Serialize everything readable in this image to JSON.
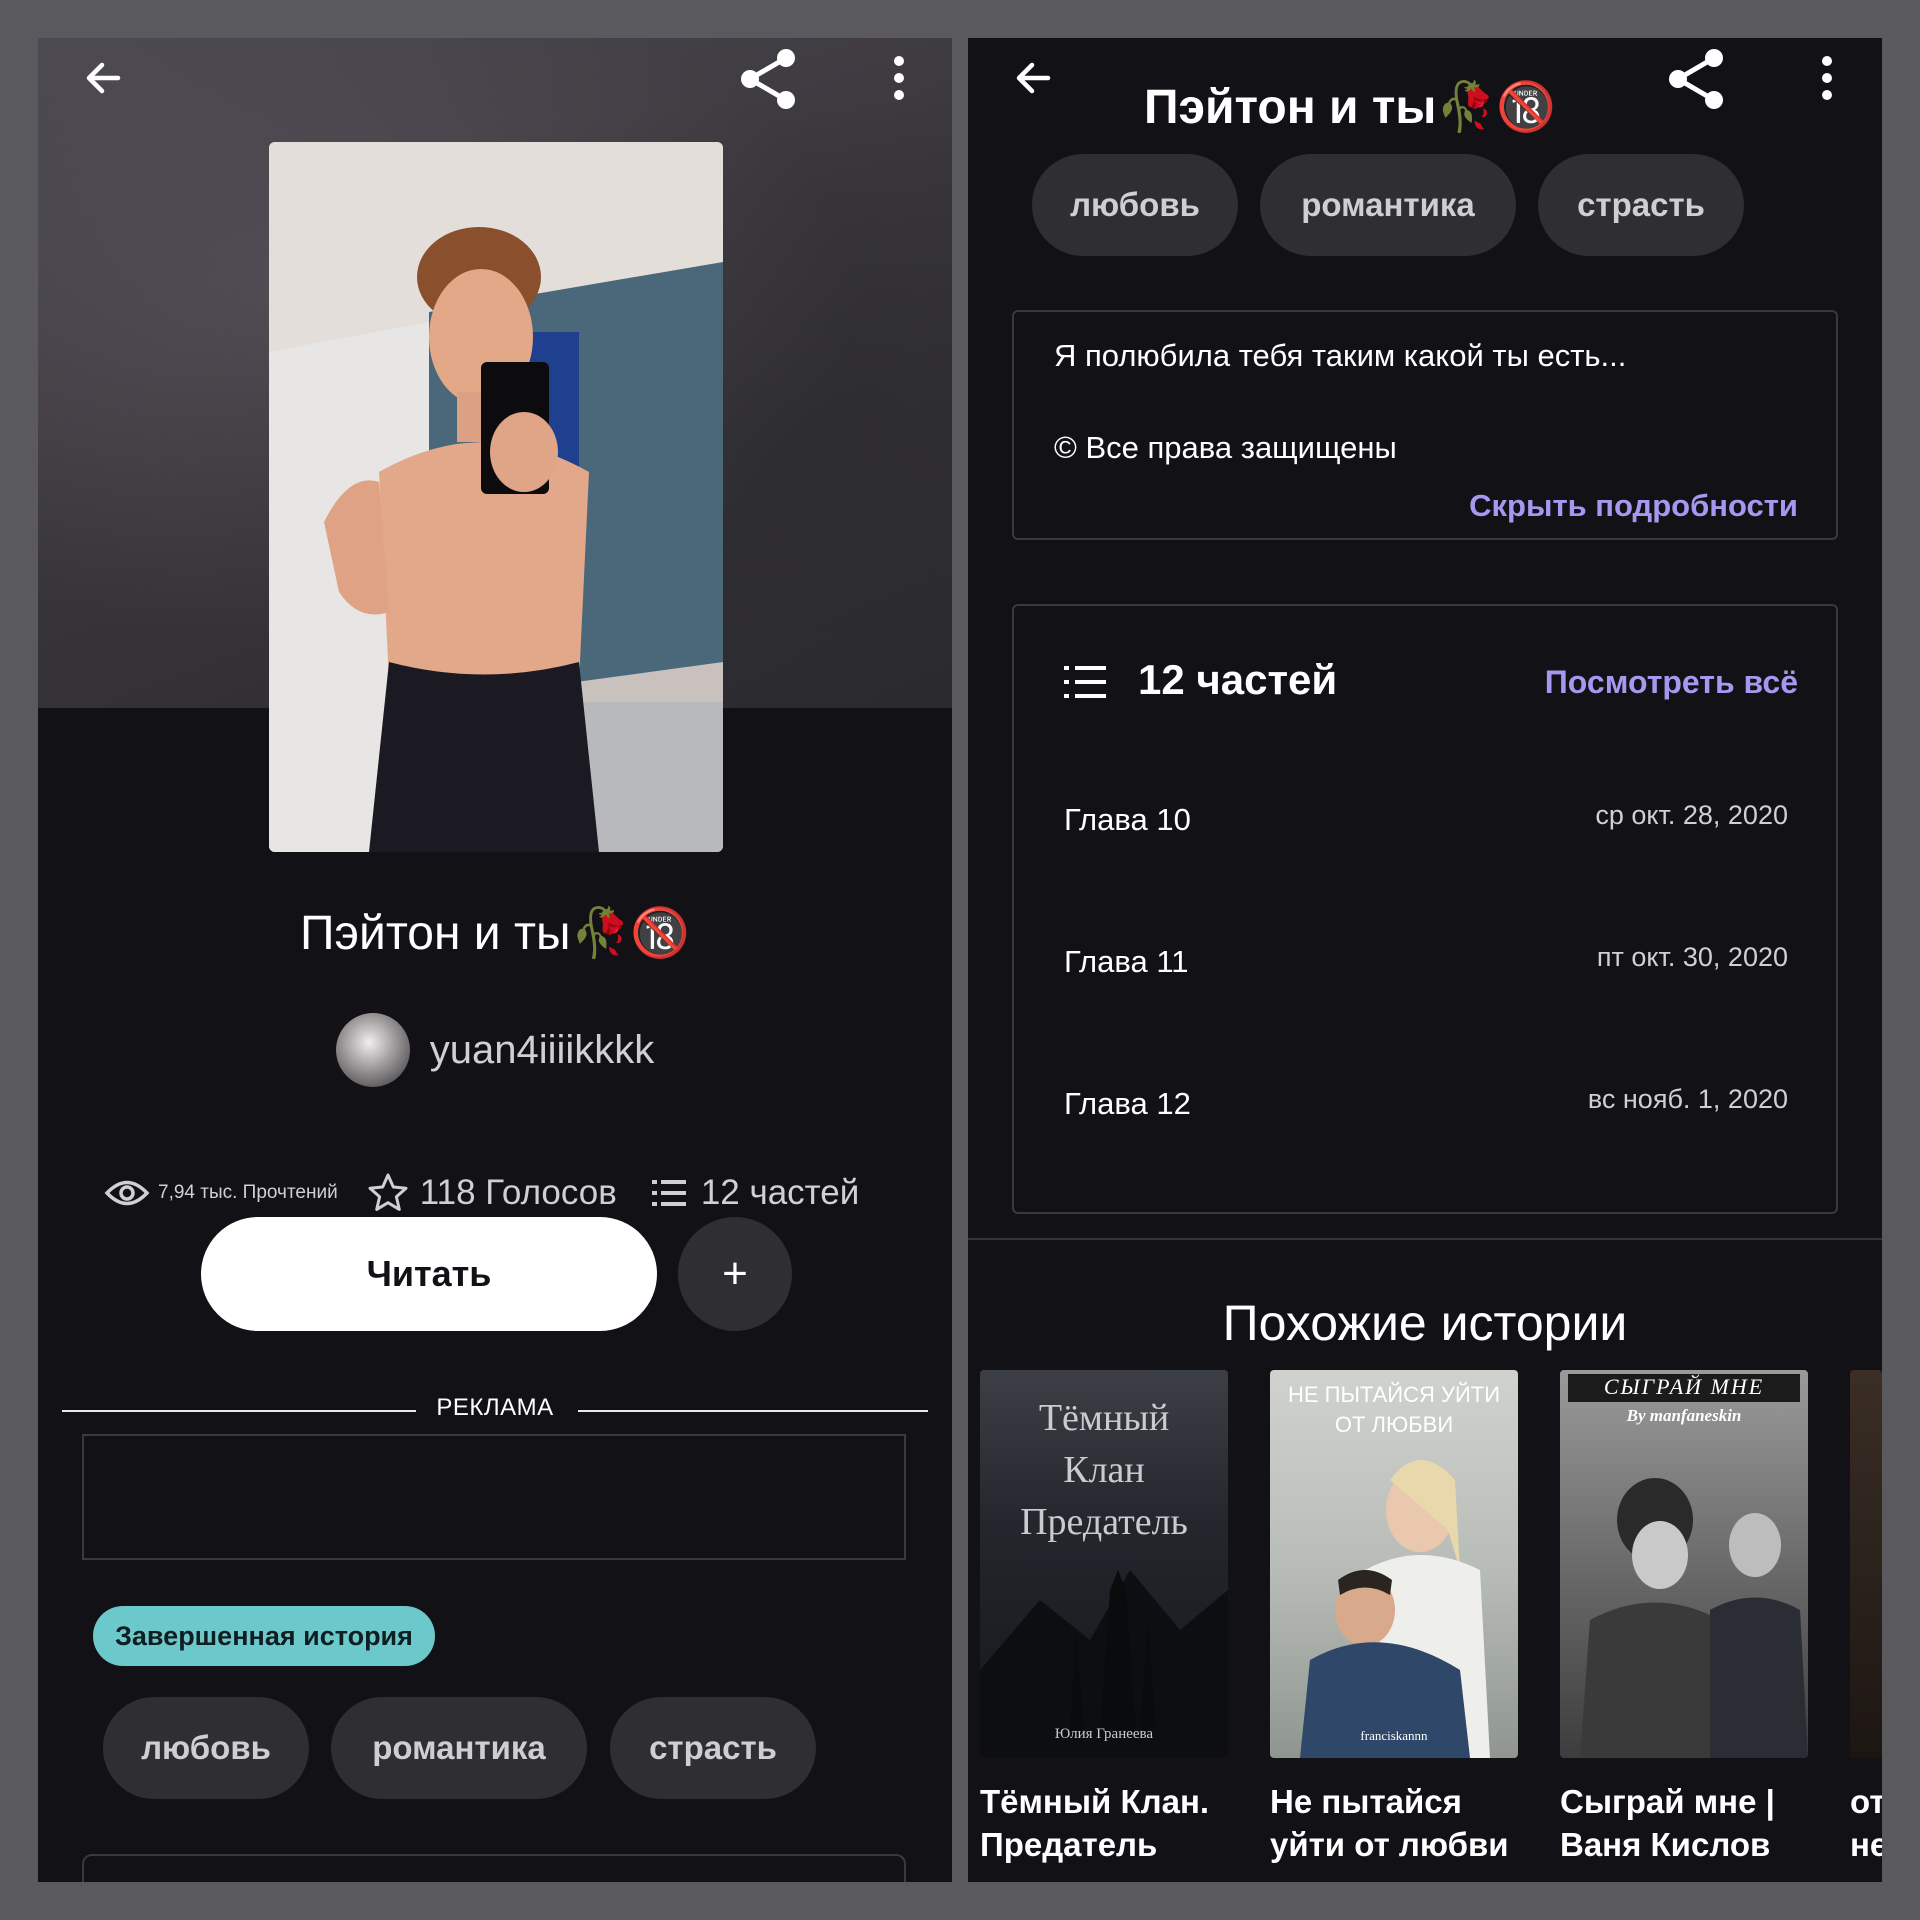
{
  "left": {
    "title": "Пэйтон и ты🥀🔞",
    "author": "yuan4iiiikkkk",
    "stats": {
      "reads": "7,94 тыс. Прочтений",
      "votes": "118 Голосов",
      "parts": "12 частей"
    },
    "read_button": "Читать",
    "add_button": "+",
    "ad_label": "РЕКЛАМА",
    "completed_badge": "Завершенная история",
    "tags": [
      "любовь",
      "романтика",
      "страсть"
    ]
  },
  "right": {
    "title": "Пэйтон и ты🥀🔞",
    "tags": [
      "любовь",
      "романтика",
      "страсть"
    ],
    "description": "Я полюбила тебя таким какой ты есть...",
    "copyright": "© Все права защищены",
    "hide_details": "Скрыть подробности",
    "parts_count": "12 частей",
    "see_all": "Посмотреть всё",
    "chapters": [
      {
        "title": "Глава 10",
        "date": "ср окт. 28, 2020"
      },
      {
        "title": "Глава 11",
        "date": "пт окт. 30, 2020"
      },
      {
        "title": "Глава 12",
        "date": "вс нояб. 1, 2020"
      }
    ],
    "similar_title": "Похожие истории",
    "similar": [
      {
        "cover_text": "Тёмный Клан Предатель",
        "cover_author": "Юлия Гранеева",
        "label_line1": "Тёмный Клан.",
        "label_line2": "Предатель"
      },
      {
        "cover_text": "НЕ ПЫТАЙСЯ УЙТИ ОТ ЛЮБВИ",
        "cover_author": "franciskannn",
        "label_line1": "Не пытайся",
        "label_line2": "уйти от любви"
      },
      {
        "cover_text": "СЫГРАЙ МНЕ",
        "cover_author": "By manfaneskin",
        "label_line1": "Сыграй мне |",
        "label_line2": "Ваня Кислов"
      },
      {
        "label_line1": "от",
        "label_line2": "не"
      }
    ]
  },
  "colors": {
    "background": "#121116",
    "accent": "#a897f0",
    "badge": "#6cc9cb",
    "chip": "#2f2e33"
  }
}
